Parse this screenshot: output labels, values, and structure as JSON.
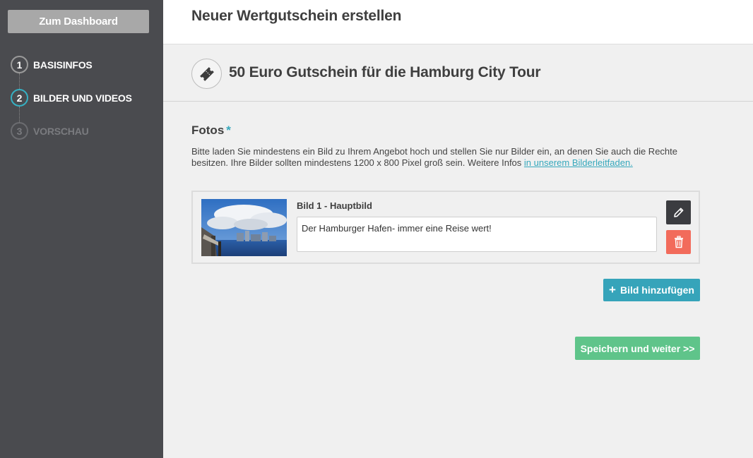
{
  "sidebar": {
    "dashboard_label": "Zum Dashboard",
    "steps": [
      {
        "num": "1",
        "label": "BASISINFOS",
        "state": "done"
      },
      {
        "num": "2",
        "label": "BILDER UND VIDEOS",
        "state": "active"
      },
      {
        "num": "3",
        "label": "VORSCHAU",
        "state": "disabled"
      }
    ]
  },
  "header": {
    "title": "Neuer Wertgutschein erstellen"
  },
  "offer": {
    "icon": "ticket-icon",
    "title": "50 Euro Gutschein für die Hamburg City Tour"
  },
  "photos": {
    "title": "Fotos",
    "required_mark": "*",
    "help_text": "Bitte laden Sie mindestens ein Bild zu Ihrem Angebot hoch und stellen Sie nur Bilder ein, an denen Sie auch die Rechte besitzen. Ihre Bilder sollten mindestens 1200 x 800 Pixel groß sein. Weitere Infos ",
    "help_link": "in unserem Bilderleitfaden.",
    "items": [
      {
        "label": "Bild 1 - Hauptbild",
        "caption": "Der Hamburger Hafen- immer eine Reise wert!"
      }
    ],
    "add_label": "Bild hinzufügen",
    "add_icon": "plus-icon"
  },
  "actions": {
    "save_label": "Speichern und weiter >>"
  },
  "colors": {
    "sidebar_bg": "#4a4b4f",
    "accent": "#36a4ba",
    "save": "#5fc48a",
    "delete": "#f26b5b",
    "edit": "#3b3c40"
  }
}
